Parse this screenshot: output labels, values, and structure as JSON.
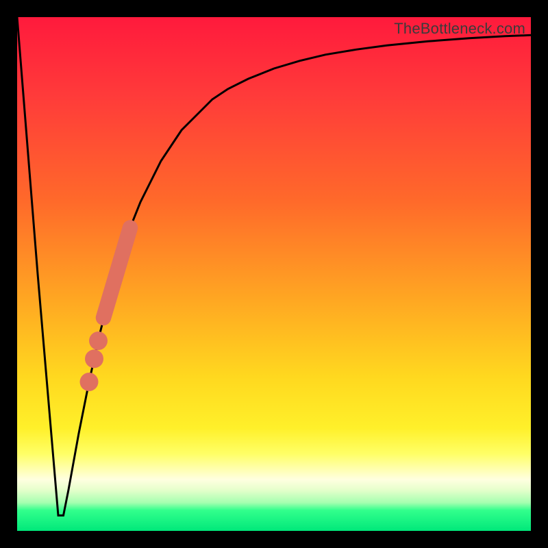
{
  "watermark": {
    "text": "TheBottleneck.com"
  },
  "colors": {
    "curve_stroke": "#000000",
    "marker_fill": "#e07060",
    "marker_stroke": "#e07060",
    "border": "#000000",
    "gradient_top": "#ff1a3c",
    "gradient_bottom": "#00e87a"
  },
  "chart_data": {
    "type": "line",
    "title": "",
    "xlabel": "",
    "ylabel": "",
    "xlim": [
      0,
      100
    ],
    "ylim": [
      0,
      100
    ],
    "grid": false,
    "series": [
      {
        "name": "curve",
        "x": [
          0,
          4,
          8,
          9,
          10,
          12,
          14,
          16,
          18,
          20,
          22,
          24,
          26,
          28,
          30,
          32,
          35,
          38,
          41,
          45,
          50,
          55,
          60,
          66,
          72,
          80,
          88,
          95,
          100
        ],
        "y": [
          100,
          50,
          3,
          3,
          8,
          19,
          29,
          38,
          46,
          53,
          59,
          64,
          68,
          72,
          75,
          78,
          81,
          84,
          86,
          88,
          90,
          91.5,
          92.7,
          93.7,
          94.5,
          95.3,
          95.9,
          96.3,
          96.5
        ]
      }
    ],
    "markers": [
      {
        "name": "outlier",
        "x": 14.0,
        "y": 29.0,
        "r": 1.0
      },
      {
        "name": "outlier",
        "x": 15.0,
        "y": 33.5,
        "r": 1.0
      },
      {
        "name": "outlier",
        "x": 15.8,
        "y": 37.0,
        "r": 1.0
      },
      {
        "name": "highlight-segment",
        "x1": 16.8,
        "y1": 41.5,
        "x2": 22.0,
        "y2": 59.0,
        "width": 2.2
      }
    ]
  }
}
